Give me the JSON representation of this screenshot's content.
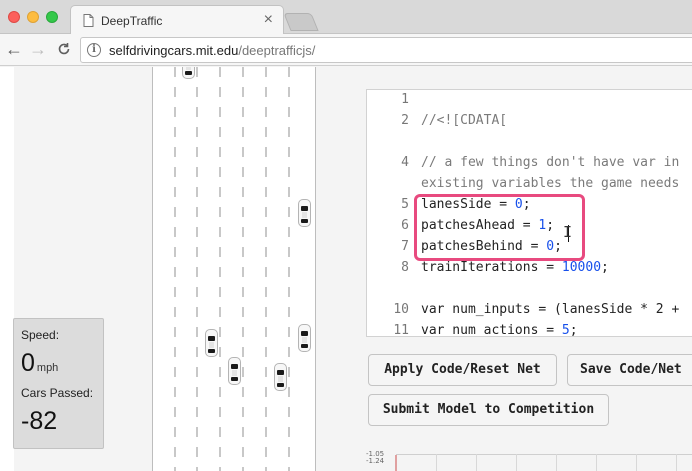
{
  "browser": {
    "tab_title": "DeepTraffic",
    "url_host": "selfdrivingcars.mit.edu",
    "url_path": "/deeptrafficjs/",
    "icons": {
      "back": "arrow-left-icon",
      "forward": "arrow-right-icon",
      "reload": "reload-icon",
      "info": "info-icon",
      "tab_favicon": "document-icon",
      "tab_close": "close-icon"
    }
  },
  "stats": {
    "speed_label": "Speed:",
    "speed_value": "0",
    "speed_unit": "mph",
    "cars_passed_label": "Cars Passed:",
    "cars_passed_value": "-82"
  },
  "code": {
    "lines": [
      {
        "n": "1",
        "text": ""
      },
      {
        "n": "2",
        "text": "//<![CDATA["
      },
      {
        "n": "",
        "text": ""
      },
      {
        "n": "4",
        "text": "// a few things don't have var in"
      },
      {
        "n": "",
        "text": "existing variables the game needs"
      },
      {
        "n": "5",
        "text": "lanesSide = 0;"
      },
      {
        "n": "6",
        "text": "patchesAhead = 1;"
      },
      {
        "n": "7",
        "text": "patchesBehind = 0;"
      },
      {
        "n": "8",
        "text": "trainIterations = 10000;"
      },
      {
        "n": "",
        "text": ""
      },
      {
        "n": "10",
        "text": "var num_inputs = (lanesSide * 2 +"
      },
      {
        "n": "11",
        "text": "var num_actions = 5;"
      }
    ]
  },
  "buttons": {
    "apply": "Apply Code/Reset Net",
    "save": "Save Code/Net",
    "submit": "Submit Model to Competition"
  },
  "graph": {
    "tick_top": "-1.05",
    "tick_second": "-1.24"
  },
  "colors": {
    "highlight": "#e84a7f",
    "number": "#1750eb"
  }
}
